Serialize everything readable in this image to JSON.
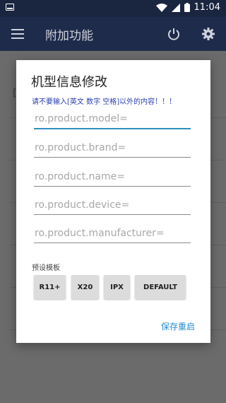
{
  "status_bar": {
    "time": "11:04"
  },
  "app_bar": {
    "title": "附加功能"
  },
  "background_list": {
    "letters": [
      "[",
      "",
      "",
      "",
      "",
      "",
      "",
      ""
    ]
  },
  "dialog": {
    "title": "机型信息修改",
    "warning": "请不要输入[英文 数字 空格]以外的内容！！！",
    "fields": [
      {
        "placeholder": "ro.product.model=",
        "value": ""
      },
      {
        "placeholder": "ro.product.brand=",
        "value": ""
      },
      {
        "placeholder": "ro.product.name=",
        "value": ""
      },
      {
        "placeholder": "ro.product.device=",
        "value": ""
      },
      {
        "placeholder": "ro.product.manufacturer=",
        "value": ""
      }
    ],
    "preset_label": "预设模板",
    "presets": [
      "R11+",
      "X20",
      "IPX",
      "DEFAULT"
    ],
    "save_label": "保存重启"
  },
  "colors": {
    "status_bar": "#1a2540",
    "app_bar": "#1e2b4b",
    "accent": "#2a8bc9",
    "warning_text": "#2a3fb0"
  }
}
